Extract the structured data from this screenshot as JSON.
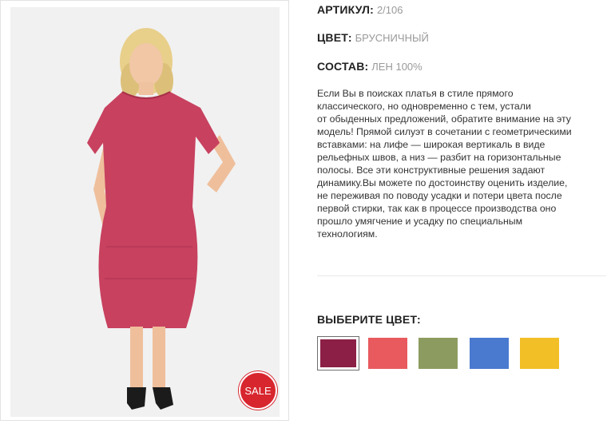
{
  "product": {
    "article_label": "АРТИКУЛ:",
    "article_value": "2/106",
    "color_label": "ЦВЕТ:",
    "color_value": "БРУСНИЧНЫЙ",
    "composition_label": "СОСТАВ:",
    "composition_value": "ЛЕН 100%",
    "sale_badge": "SALE",
    "description_lines": [
      "Если Вы в поисках платья в стиле прямого",
      "классического, но одновременно с тем, устали",
      "от обыденных предложений, обратите внимание на эту",
      "модель! Прямой силуэт в сочетании с геометрическими",
      "вставками: на лифе — широкая вертикаль в виде",
      "рельефных швов, а низ — разбит на горизонтальные",
      "полосы. Все эти конструктивные решения задают",
      "динамику.Вы можете по достоинству оценить изделие,",
      "не переживая по поводу усадки и потери цвета после",
      "первой стирки, так как в процессе производства оно",
      "прошло умягчение и усадку по специальным",
      "технологиям."
    ]
  },
  "color_picker": {
    "title": "ВЫБЕРИТЕ ЦВЕТ:",
    "selected": "brusnichny",
    "swatches": [
      {
        "id": "brusnichny",
        "hex": "#8b1f45"
      },
      {
        "id": "coral",
        "hex": "#e85a5e"
      },
      {
        "id": "olive",
        "hex": "#8c9c60"
      },
      {
        "id": "blue",
        "hex": "#4a79d0"
      },
      {
        "id": "yellow",
        "hex": "#f2bf26"
      }
    ]
  },
  "colors": {
    "sale": "#d8262e",
    "dress": "#c8415f"
  }
}
